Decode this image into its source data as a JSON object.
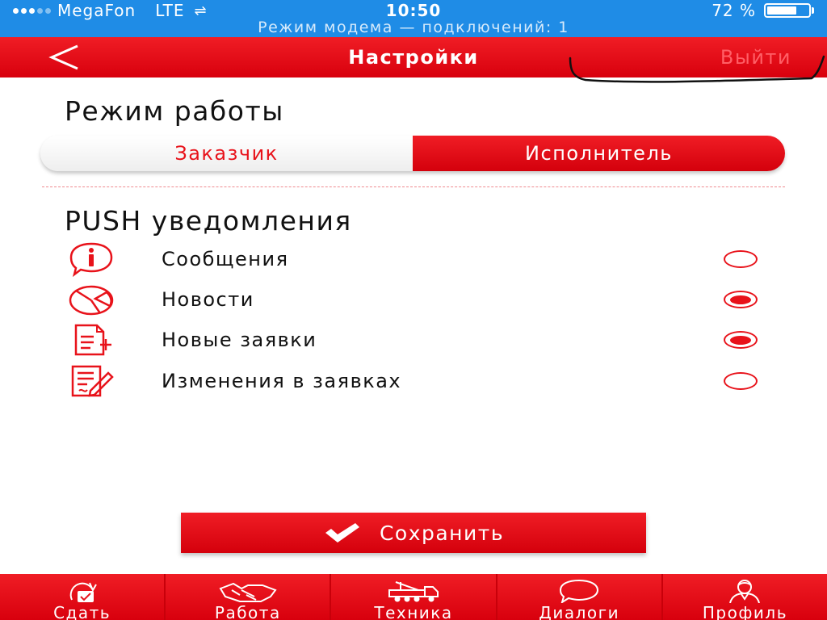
{
  "status_bar": {
    "carrier": "MegaFon",
    "network": "LTE",
    "time": "10:50",
    "battery_percent": "72 %",
    "battery_level": 0.72,
    "hotspot_banner": "Режим модема — подключений: 1"
  },
  "nav": {
    "back_icon": "chevron-left-icon",
    "title": "Настройки",
    "logout_label": "Выйти"
  },
  "mode": {
    "title": "Режим работы",
    "options": [
      "Заказчик",
      "Исполнитель"
    ],
    "selected": "Исполнитель"
  },
  "push": {
    "title": "PUSH уведомления",
    "items": [
      {
        "label": "Сообщения",
        "icon": "info-bubble-icon",
        "checked": false
      },
      {
        "label": "Новости",
        "icon": "news-pie-icon",
        "checked": true
      },
      {
        "label": "Новые заявки",
        "icon": "document-add-icon",
        "checked": true
      },
      {
        "label": "Изменения в заявках",
        "icon": "document-edit-icon",
        "checked": false
      }
    ]
  },
  "save_label": "Сохранить",
  "tabs": [
    {
      "label": "Сдать",
      "icon": "refresh-calendar-icon"
    },
    {
      "label": "Работа",
      "icon": "handshake-icon"
    },
    {
      "label": "Техника",
      "icon": "truck-icon"
    },
    {
      "label": "Диалоги",
      "icon": "chat-bubble-icon"
    },
    {
      "label": "Профиль",
      "icon": "user-icon"
    }
  ],
  "colors": {
    "brand_red": "#e8121a",
    "status_blue": "#1f8ce6",
    "white": "#ffffff"
  }
}
